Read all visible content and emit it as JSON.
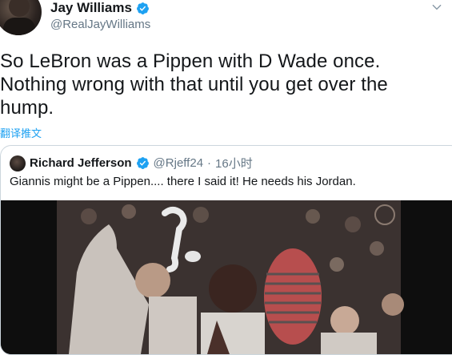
{
  "tweet": {
    "author_name": "Jay Williams",
    "author_handle": "@RealJayWilliams",
    "text_line1": "So LeBron was a Pippen with D Wade once.",
    "text_line2": "Nothing wrong with that until you get over the",
    "text_line3": "hump.",
    "translate_label": "翻译推文"
  },
  "quote": {
    "author_name": "Richard Jefferson",
    "author_handle": "@Rjeff24",
    "separator": "·",
    "time": "16小时",
    "text": "Giannis might be a Pippen.... there I said it! He needs his Jordan."
  },
  "colors": {
    "verified": "#1da1f2",
    "link": "#1da1f2",
    "secondary_text": "#657786",
    "border": "#ccd6dd"
  },
  "icons": {
    "verified": "verified-badge-icon",
    "caret": "chevron-down-icon"
  }
}
